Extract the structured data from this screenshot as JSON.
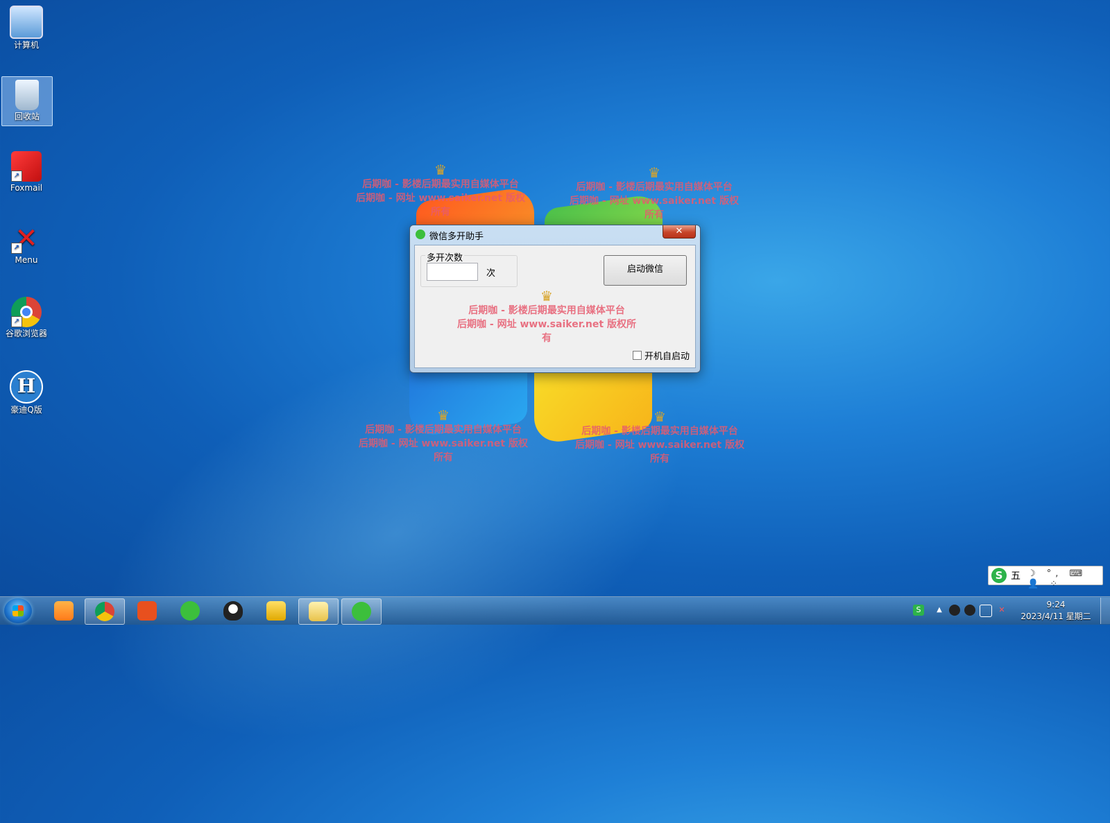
{
  "desktop": {
    "icons": [
      {
        "label": "计算机"
      },
      {
        "label": "回收站"
      },
      {
        "label": "Foxmail"
      },
      {
        "label": "Menu"
      },
      {
        "label": "谷歌浏览器"
      },
      {
        "label": "豪迪Q版"
      }
    ]
  },
  "watermark": {
    "line1": "后期咖 - 影楼后期最实用自媒体平台",
    "line2": "后期咖 - 网址 www.saiker.net 版权所有",
    "crown": "♛"
  },
  "dialog": {
    "title": "微信多开助手",
    "close_glyph": "✕",
    "group_label": "多开次数",
    "count_value": "",
    "unit_label": "次",
    "launch_label": "启动微信",
    "autostart_label": "开机自启动",
    "autostart_checked": false
  },
  "ime": {
    "logo": "S",
    "mode": "五",
    "symbols": "☽ °, ⌨ 👤 ⁘"
  },
  "tray": {
    "time": "9:24",
    "date": "2023/4/11 星期二"
  },
  "colors": {
    "watermark": "#e65a6e",
    "crown": "#d8a42a",
    "close_button": "#c7452a"
  }
}
